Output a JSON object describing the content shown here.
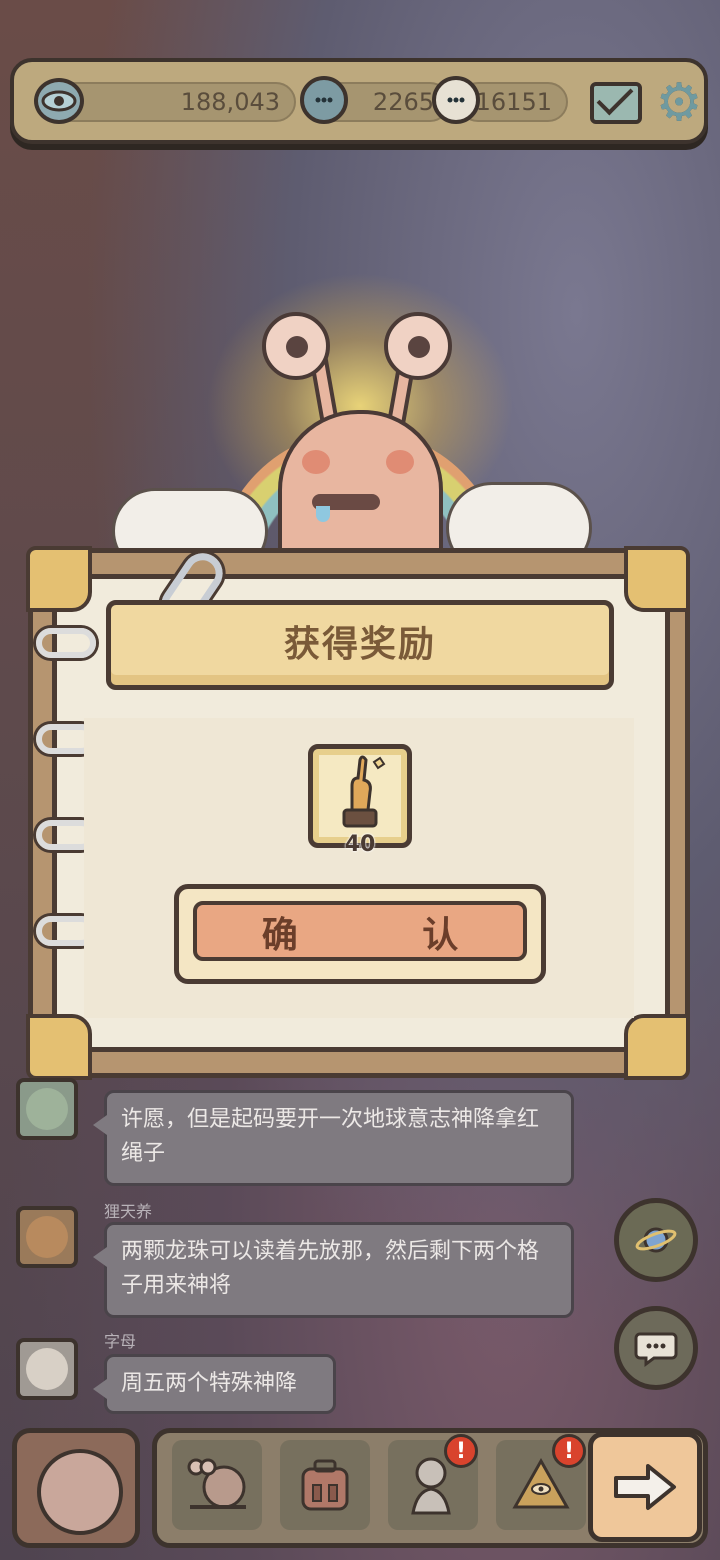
{
  "header": {
    "eye_value": "188,043",
    "chat_value": "2265",
    "bubble_value": "16151"
  },
  "dialog": {
    "title": "获得奖励",
    "reward_count": "40",
    "confirm_label": "确 认"
  },
  "chat": [
    {
      "name": "",
      "message": "许愿，但是起码要开一次地球意志神降拿红绳子"
    },
    {
      "name": "狸天养",
      "message": "两颗龙珠可以读着先放那，然后剩下两个格子用来神将"
    },
    {
      "name": "字母",
      "message": "周五两个特殊神降"
    }
  ],
  "badges": {
    "alert_1": "!",
    "alert_2": "!"
  },
  "colors": {
    "panel": "#f1ebdc",
    "button": "#e9a783",
    "accent_gold": "#e4c072"
  },
  "icons": {
    "eye": "eye-icon",
    "chat": "speech-bubble-icon",
    "mail": "envelope-icon",
    "settings": "gear-icon",
    "reward": "statue-hand-icon",
    "next": "arrow-right-icon"
  }
}
